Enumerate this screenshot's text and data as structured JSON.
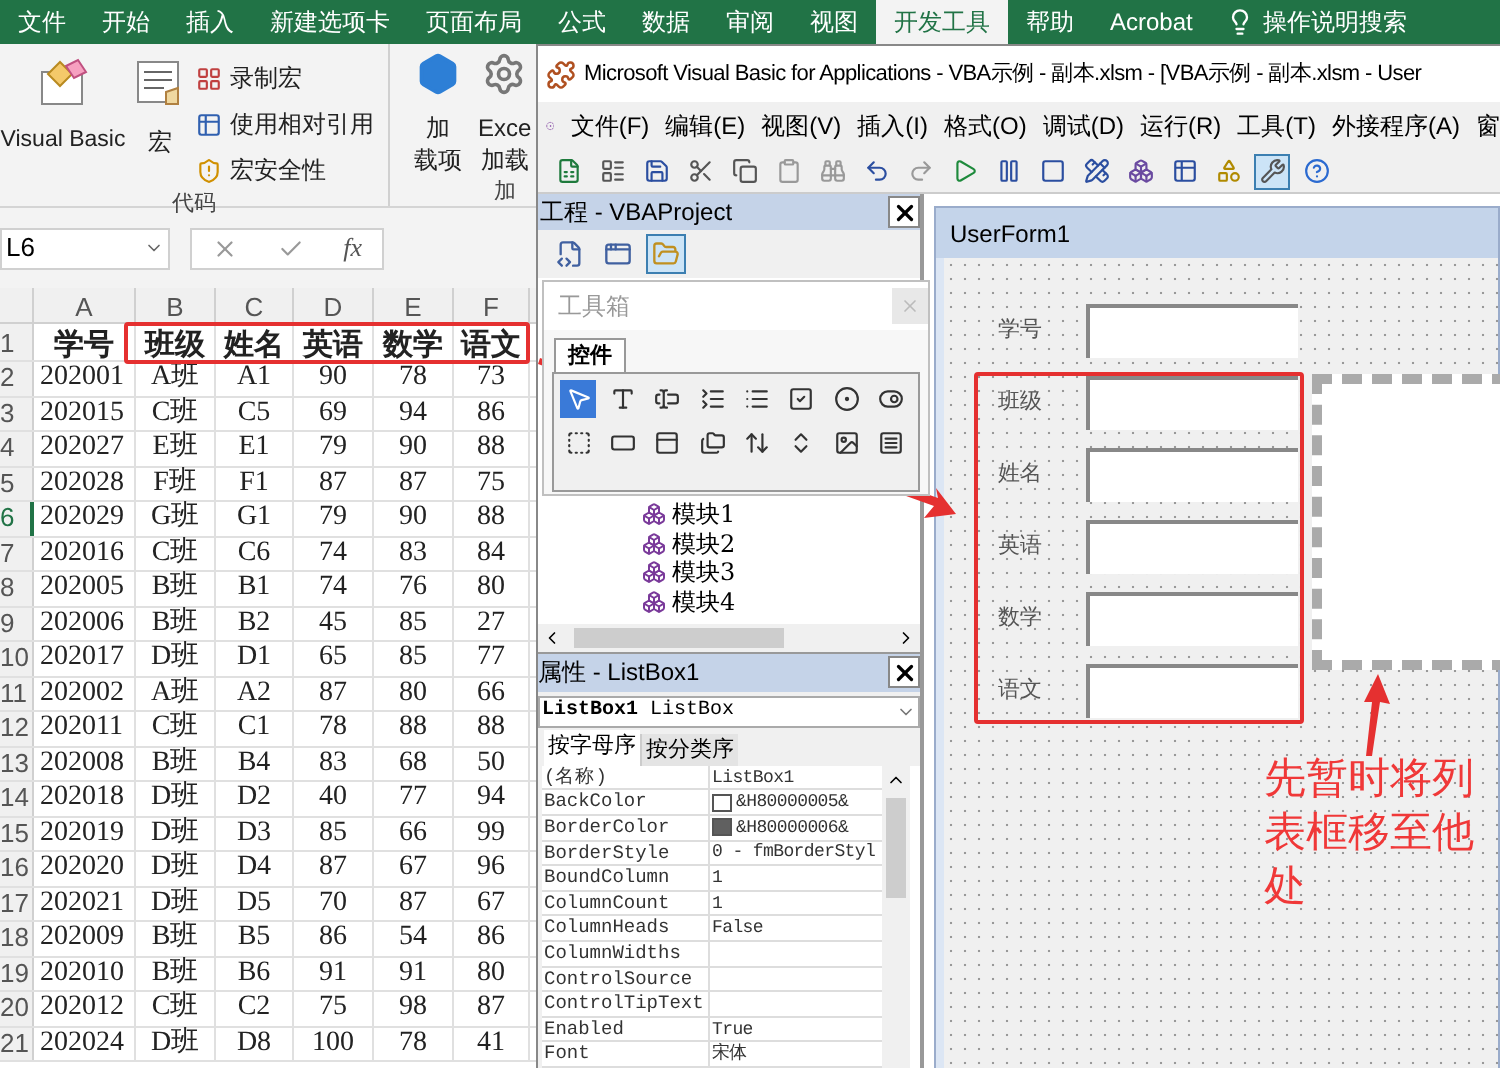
{
  "excel": {
    "tabs": [
      {
        "label": "文件",
        "selected": false
      },
      {
        "label": "开始",
        "selected": false
      },
      {
        "label": "插入",
        "selected": false
      },
      {
        "label": "新建选项卡",
        "selected": false
      },
      {
        "label": "页面布局",
        "selected": false
      },
      {
        "label": "公式",
        "selected": false
      },
      {
        "label": "数据",
        "selected": false
      },
      {
        "label": "审阅",
        "selected": false
      },
      {
        "label": "视图",
        "selected": false
      },
      {
        "label": "开发工具",
        "selected": true
      },
      {
        "label": "帮助",
        "selected": false
      },
      {
        "label": "Acrobat",
        "selected": false
      }
    ],
    "tell_me": "操作说明搜索",
    "ribbon": {
      "code_group": {
        "visual_basic": "Visual Basic",
        "macros": "宏",
        "small_items": [
          "录制宏",
          "使用相对引用",
          "宏安全性"
        ],
        "label": "代码"
      },
      "addins_group": {
        "addins_lines": [
          "加",
          "载项"
        ],
        "excel_addins_lines": [
          "Exce",
          "加载"
        ],
        "label": "加"
      }
    },
    "name_box": "L6",
    "function_label": "fx",
    "columns": [
      "A",
      "B",
      "C",
      "D",
      "E",
      "F"
    ],
    "header_row": {
      "number": "1",
      "cells": [
        "学号",
        "班级",
        "姓名",
        "英语",
        "数学",
        "语文"
      ]
    },
    "rows": [
      {
        "number": "2",
        "selected": false,
        "cells": [
          "202001",
          "A班",
          "A1",
          "90",
          "78",
          "73"
        ]
      },
      {
        "number": "3",
        "selected": false,
        "cells": [
          "202015",
          "C班",
          "C5",
          "69",
          "94",
          "86"
        ]
      },
      {
        "number": "4",
        "selected": false,
        "cells": [
          "202027",
          "E班",
          "E1",
          "79",
          "90",
          "88"
        ]
      },
      {
        "number": "5",
        "selected": false,
        "cells": [
          "202028",
          "F班",
          "F1",
          "87",
          "87",
          "75"
        ]
      },
      {
        "number": "6",
        "selected": true,
        "cells": [
          "202029",
          "G班",
          "G1",
          "79",
          "90",
          "88"
        ]
      },
      {
        "number": "7",
        "selected": false,
        "cells": [
          "202016",
          "C班",
          "C6",
          "74",
          "83",
          "84"
        ]
      },
      {
        "number": "8",
        "selected": false,
        "cells": [
          "202005",
          "B班",
          "B1",
          "74",
          "76",
          "80"
        ]
      },
      {
        "number": "9",
        "selected": false,
        "cells": [
          "202006",
          "B班",
          "B2",
          "45",
          "85",
          "27"
        ]
      },
      {
        "number": "10",
        "selected": false,
        "cells": [
          "202017",
          "D班",
          "D1",
          "65",
          "85",
          "77"
        ]
      },
      {
        "number": "11",
        "selected": false,
        "cells": [
          "202002",
          "A班",
          "A2",
          "87",
          "80",
          "66"
        ]
      },
      {
        "number": "12",
        "selected": false,
        "cells": [
          "202011",
          "C班",
          "C1",
          "78",
          "88",
          "88"
        ]
      },
      {
        "number": "13",
        "selected": false,
        "cells": [
          "202008",
          "B班",
          "B4",
          "83",
          "68",
          "50"
        ]
      },
      {
        "number": "14",
        "selected": false,
        "cells": [
          "202018",
          "D班",
          "D2",
          "40",
          "77",
          "94"
        ]
      },
      {
        "number": "15",
        "selected": false,
        "cells": [
          "202019",
          "D班",
          "D3",
          "85",
          "66",
          "99"
        ]
      },
      {
        "number": "16",
        "selected": false,
        "cells": [
          "202020",
          "D班",
          "D4",
          "87",
          "67",
          "96"
        ]
      },
      {
        "number": "17",
        "selected": false,
        "cells": [
          "202021",
          "D班",
          "D5",
          "70",
          "87",
          "67"
        ]
      },
      {
        "number": "18",
        "selected": false,
        "cells": [
          "202009",
          "B班",
          "B5",
          "86",
          "54",
          "86"
        ]
      },
      {
        "number": "19",
        "selected": false,
        "cells": [
          "202010",
          "B班",
          "B6",
          "91",
          "91",
          "80"
        ]
      },
      {
        "number": "20",
        "selected": false,
        "cells": [
          "202012",
          "C班",
          "C2",
          "75",
          "98",
          "87"
        ]
      },
      {
        "number": "21",
        "selected": false,
        "cells": [
          "202024",
          "D班",
          "D8",
          "100",
          "78",
          "41"
        ]
      }
    ]
  },
  "vba": {
    "title": "Microsoft Visual Basic for Applications - VBA示例 - 副本.xlsm - [VBA示例 - 副本.xlsm - User",
    "menu": [
      "文件(F)",
      "编辑(E)",
      "视图(V)",
      "插入(I)",
      "格式(O)",
      "调试(D)",
      "运行(R)",
      "工具(T)",
      "外接程序(A)",
      "窗"
    ],
    "toolbar": [
      {
        "pressed": false
      },
      {
        "pressed": false
      },
      {
        "pressed": false
      },
      {
        "pressed": false
      },
      {
        "pressed": false
      },
      {
        "pressed": false
      },
      {
        "pressed": false
      },
      {
        "pressed": false
      },
      {
        "pressed": false
      },
      {
        "pressed": false
      },
      {
        "pressed": false
      },
      {
        "pressed": false
      },
      {
        "pressed": false
      },
      {
        "pressed": false
      },
      {
        "pressed": false
      },
      {
        "pressed": false
      },
      {
        "pressed": true
      },
      {
        "pressed": false
      }
    ],
    "project": {
      "title": "工程 - VBAProject",
      "view_buttons": [
        {
          "selected": false
        },
        {
          "selected": false
        },
        {
          "selected": true
        }
      ],
      "modules": [
        "模块1",
        "模块2",
        "模块3",
        "模块4"
      ]
    },
    "toolbox": {
      "title": "工具箱",
      "tab": "控件",
      "controls": [
        {
          "selected": true
        },
        {
          "selected": false
        },
        {
          "selected": false
        },
        {
          "selected": false
        },
        {
          "selected": false
        },
        {
          "selected": false
        },
        {
          "selected": false
        },
        {
          "selected": false
        },
        {
          "selected": false
        },
        {
          "selected": false
        },
        {
          "selected": false
        },
        {
          "selected": false
        },
        {
          "selected": false
        },
        {
          "selected": false
        },
        {
          "selected": false
        },
        {
          "selected": false
        }
      ]
    },
    "properties": {
      "title": "属性 - ListBox1",
      "object": "ListBox1",
      "object_type": "ListBox",
      "tabs": [
        {
          "label": "按字母序",
          "selected": true
        },
        {
          "label": "按分类序",
          "selected": false
        }
      ],
      "rows": [
        {
          "name": "(名称)",
          "value": "ListBox1"
        },
        {
          "name": "BackColor",
          "value": "&H80000005&",
          "color": "#ffffff"
        },
        {
          "name": "BorderColor",
          "value": "&H80000006&",
          "color": "#606060"
        },
        {
          "name": "BorderStyle",
          "value": "0 - fmBorderStyl"
        },
        {
          "name": "BoundColumn",
          "value": "1"
        },
        {
          "name": "ColumnCount",
          "value": "1"
        },
        {
          "name": "ColumnHeads",
          "value": "False"
        },
        {
          "name": "ColumnWidths"
        },
        {
          "name": "ControlSource"
        },
        {
          "name": "ControlTipText"
        },
        {
          "name": "Enabled",
          "value": "True"
        },
        {
          "name": "Font",
          "value": "宋体"
        }
      ]
    },
    "userform": {
      "title": "UserForm1",
      "fields": [
        "学号",
        "班级",
        "姓名",
        "英语",
        "数学",
        "语文"
      ]
    }
  },
  "annotation": "先暂时将列表框移至他处"
}
